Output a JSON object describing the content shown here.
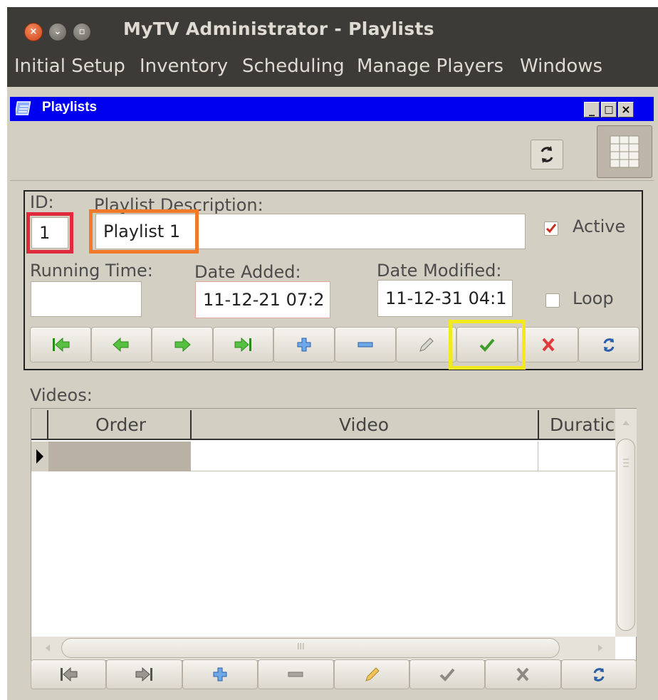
{
  "window": {
    "title": "MyTV Administrator - Playlists"
  },
  "menu": [
    "Initial Setup",
    "Inventory",
    "Scheduling",
    "Manage Players",
    "Windows"
  ],
  "inner_window": {
    "title": "Playlists"
  },
  "form": {
    "id_label": "ID:",
    "id_value": "1",
    "desc_label": "Playlist Description:",
    "desc_value": "Playlist 1",
    "active_label": "Active",
    "active_checked": true,
    "running_time_label": "Running Time:",
    "running_time_value": "",
    "date_added_label": "Date Added:",
    "date_added_value": "11-12-21 07:2",
    "date_modified_label": "Date Modified:",
    "date_modified_value": "11-12-31 04:1",
    "loop_label": "Loop",
    "loop_checked": false
  },
  "record_nav_buttons": [
    "first-record-icon",
    "prior-record-icon",
    "next-record-icon",
    "last-record-icon",
    "insert-icon",
    "delete-icon",
    "edit-icon",
    "post-icon",
    "cancel-icon",
    "refresh-icon"
  ],
  "videos": {
    "label": "Videos:",
    "columns": [
      "Order",
      "Video",
      "Duratic"
    ],
    "rows": [
      {
        "order": "",
        "video": "",
        "duration": ""
      }
    ],
    "hscroll_grip": "III"
  },
  "video_nav_buttons": [
    "first-record-icon",
    "prior-record-icon",
    "insert-icon",
    "delete-icon",
    "edit-icon",
    "post-icon",
    "cancel-icon",
    "refresh-icon"
  ],
  "colors": {
    "accent_blue": "#0000f0",
    "highlight_red": "#e02a3c",
    "highlight_orange": "#f07a2a",
    "highlight_yellow": "#f2ea1c"
  }
}
